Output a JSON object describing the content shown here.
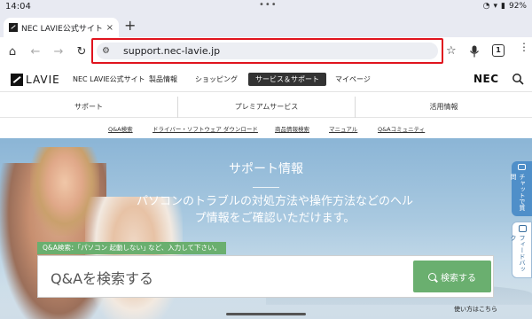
{
  "status_bar": {
    "time": "14:04",
    "battery": "92%"
  },
  "browser": {
    "tab_title": "NEC LAVIE公式サイト > サー",
    "tab_close": "×",
    "new_tab": "+",
    "url": "support.nec-lavie.jp",
    "tab_count": "1"
  },
  "site": {
    "logo_text": "LAVIE",
    "site_name": "NEC LAVIE公式サイト",
    "nav": [
      "製品情報",
      "ショッピング",
      "サービス＆サポート",
      "マイページ"
    ],
    "brand": "NEC"
  },
  "categories": [
    "サポート",
    "プレミアムサービス",
    "活用情報"
  ],
  "sub_links": [
    "Q&A検索",
    "ドライバー・ソフトウェア ダウンロード",
    "商品情報検索",
    "マニュアル",
    "Q&Aコミュニティ"
  ],
  "hero": {
    "title": "サポート情報",
    "subtitle": "パソコンのトラブルの対処方法や操作方法などのヘルプ情報をご確認いただけます。",
    "hint": "Q&A検索：｢パソコン 起動しない｣ など、入力して下さい。",
    "search_placeholder": "Q&Aを検索する",
    "search_button": "検索する",
    "usage_link": "使い方はこちら"
  },
  "side_tabs": {
    "chat": "チャットで質問",
    "feedback": "フィードバック"
  }
}
